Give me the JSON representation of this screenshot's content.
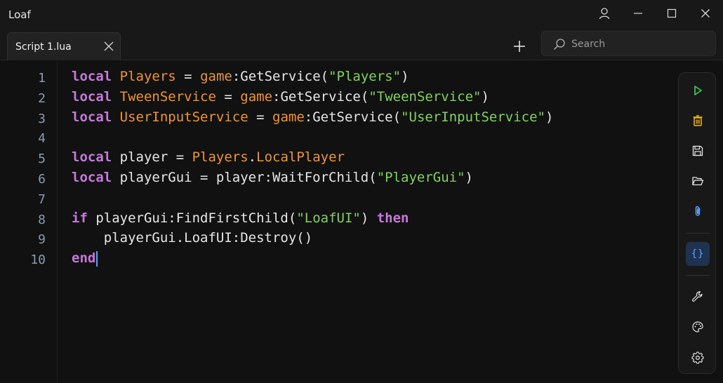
{
  "window": {
    "title": "Loaf"
  },
  "tabs": [
    {
      "label": "Script 1.lua"
    }
  ],
  "search": {
    "placeholder": "Search"
  },
  "editor": {
    "line_numbers": [
      "1",
      "2",
      "3",
      "4",
      "5",
      "6",
      "7",
      "8",
      "9",
      "10"
    ],
    "lines": [
      [
        [
          "kw",
          "local"
        ],
        [
          "plain",
          " "
        ],
        [
          "var",
          "Players"
        ],
        [
          "plain",
          " = "
        ],
        [
          "var",
          "game"
        ],
        [
          "plain",
          ":GetService("
        ],
        [
          "str",
          "\"Players\""
        ],
        [
          "plain",
          ")"
        ]
      ],
      [
        [
          "kw",
          "local"
        ],
        [
          "plain",
          " "
        ],
        [
          "var",
          "TweenService"
        ],
        [
          "plain",
          " = "
        ],
        [
          "var",
          "game"
        ],
        [
          "plain",
          ":GetService("
        ],
        [
          "str",
          "\"TweenService\""
        ],
        [
          "plain",
          ")"
        ]
      ],
      [
        [
          "kw",
          "local"
        ],
        [
          "plain",
          " "
        ],
        [
          "var",
          "UserInputService"
        ],
        [
          "plain",
          " = "
        ],
        [
          "var",
          "game"
        ],
        [
          "plain",
          ":GetService("
        ],
        [
          "str",
          "\"UserInputService\""
        ],
        [
          "plain",
          ")"
        ]
      ],
      [],
      [
        [
          "kw",
          "local"
        ],
        [
          "plain",
          " player = "
        ],
        [
          "var",
          "Players"
        ],
        [
          "plain",
          "."
        ],
        [
          "var",
          "LocalPlayer"
        ]
      ],
      [
        [
          "kw",
          "local"
        ],
        [
          "plain",
          " playerGui = player:WaitForChild("
        ],
        [
          "str",
          "\"PlayerGui\""
        ],
        [
          "plain",
          ")"
        ]
      ],
      [],
      [
        [
          "kw",
          "if"
        ],
        [
          "plain",
          " playerGui:FindFirstChild("
        ],
        [
          "str",
          "\"LoafUI\""
        ],
        [
          "plain",
          ") "
        ],
        [
          "kw",
          "then"
        ]
      ],
      [
        [
          "plain",
          "    playerGui.LoafUI:Destroy()"
        ]
      ],
      [
        [
          "kw",
          "end"
        ]
      ]
    ],
    "cursor_line": 10
  },
  "toolbar": {
    "buttons": [
      {
        "name": "run-button",
        "icon": "play-icon",
        "color": "#3ecf5a"
      },
      {
        "name": "clear-button",
        "icon": "trash-icon",
        "color": "#f2b51d"
      },
      {
        "name": "save-button",
        "icon": "save-icon",
        "color": "#e6e6e6"
      },
      {
        "name": "open-button",
        "icon": "folder-open-icon",
        "color": "#e6e6e6"
      },
      {
        "name": "attach-button",
        "icon": "paperclip-icon",
        "color": "#5aa6ff"
      },
      {
        "name": "format-button",
        "icon": "braces-icon",
        "color": "#5aa6ff",
        "active": true
      },
      {
        "name": "tools-button",
        "icon": "wrench-icon",
        "color": "#e6e6e6"
      },
      {
        "name": "theme-button",
        "icon": "palette-icon",
        "color": "#e6e6e6"
      },
      {
        "name": "settings-button",
        "icon": "gear-icon",
        "color": "#e6e6e6"
      }
    ]
  },
  "colors": {
    "background": "#111111",
    "keyword": "#c678dd",
    "identifier": "#f0952e",
    "string": "#7fd45a",
    "line_number": "#8a9bb0",
    "accent": "#5aa6ff"
  }
}
